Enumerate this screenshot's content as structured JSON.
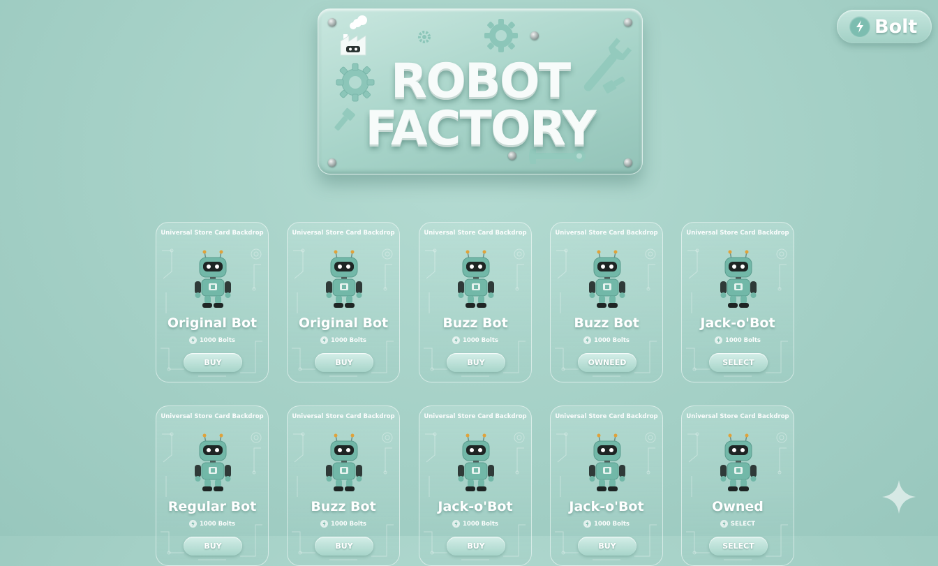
{
  "game": {
    "title_line1": "ROBOT",
    "title_line2": "FACTORY"
  },
  "currency": {
    "label": "Bolt",
    "icon": "bolt-icon"
  },
  "store": {
    "cards": [
      {
        "header": "Universal Store Card Backdrop",
        "name": "Original Bot",
        "price": "1000 Bolts",
        "action": "BUY"
      },
      {
        "header": "Universal Store Card Backdrop",
        "name": "Original Bot",
        "price": "1000 Bolts",
        "action": "BUY"
      },
      {
        "header": "Universal Store Card Backdrop",
        "name": "Buzz Bot",
        "price": "1000 Bolts",
        "action": "BUY"
      },
      {
        "header": "Universal Store Card Backdrop",
        "name": "Buzz Bot",
        "price": "1000 Bolts",
        "action": "OWNEED"
      },
      {
        "header": "Universal Store Card Backdrop",
        "name": "Jack-o'Bot",
        "price": "1000 Bolts",
        "action": "SELECT"
      },
      {
        "header": "Universal Store Card Backdrop",
        "name": "Regular Bot",
        "price": "1000 Bolts",
        "action": "BUY"
      },
      {
        "header": "Universal Store Card Backdrop",
        "name": "Buzz Bot",
        "price": "1000 Bolts",
        "action": "BUY"
      },
      {
        "header": "Universal Store Card Backdrop",
        "name": "Jack-o'Bot",
        "price": "1000 Bolts",
        "action": "BUY"
      },
      {
        "header": "Universal Store Card Backdrop",
        "name": "Jack-o'Bot",
        "price": "1000 Bolts",
        "action": "BUY"
      },
      {
        "header": "Universal Store Card Backdrop",
        "name": "Owned",
        "price": "SELECT",
        "action": "SELECT"
      }
    ]
  },
  "colors": {
    "background": "#a7d2c8",
    "robot_body": "#6fb5a6",
    "robot_visor": "#1e2524",
    "robot_antenna_tip": "#e0a23a"
  }
}
